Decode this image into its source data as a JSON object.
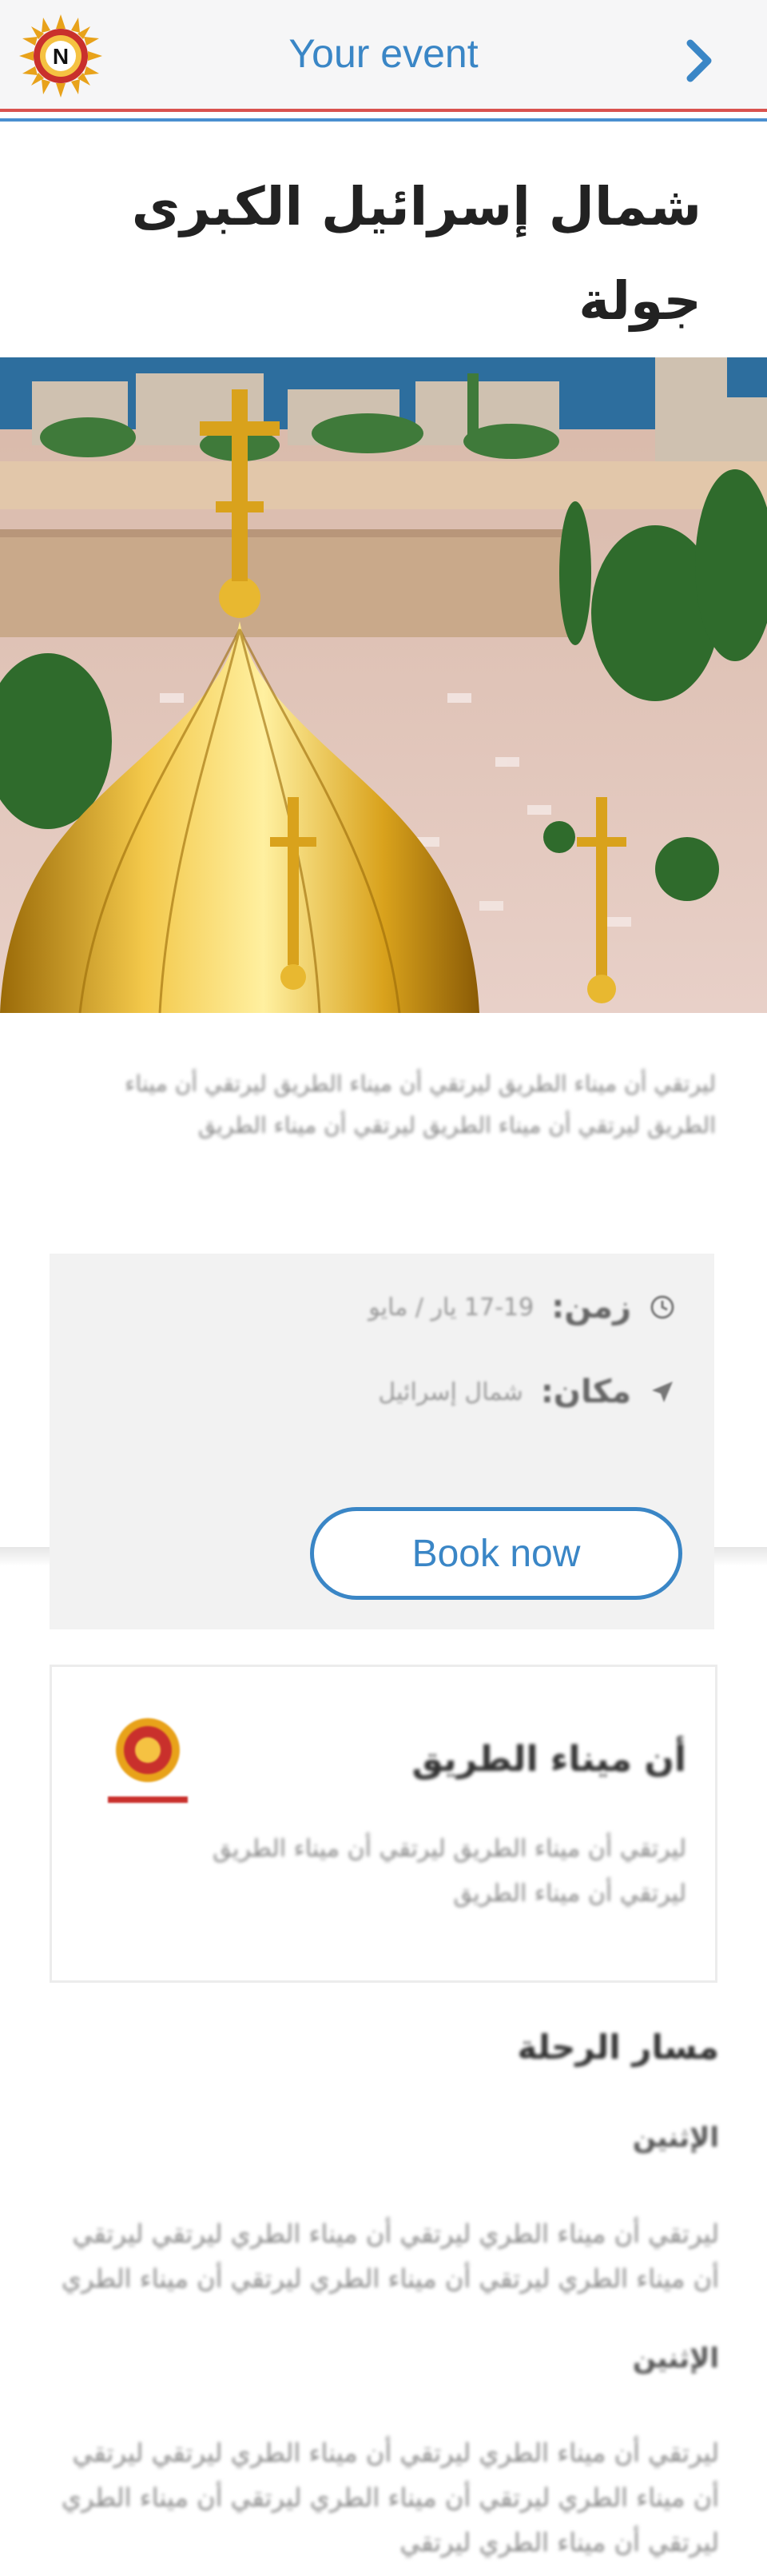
{
  "header": {
    "title": "Your event",
    "logo_letter": "N"
  },
  "event": {
    "title_line1": "شمال إسرائيل الكبرى",
    "title_line2": "جولة"
  },
  "intro": "ليرتقي أن ميناء الطريق ليرتقي أن ميناء الطريق ليرتقي أن ميناء الطريق ليرتقي أن ميناء الطريق ليرتقي أن ميناء الطريق",
  "info": {
    "time_label": "زمن:",
    "time_value": "17-19 يار / مايو",
    "place_label": "مكان:",
    "place_value": "شمال إسرائيل"
  },
  "book_button": "Book now",
  "organizer": {
    "name": "أن ميناء الطريق",
    "text": "ليرتقي أن ميناء الطريق ليرتقي أن ميناء الطريق ليرتقي أن ميناء الطريق"
  },
  "itinerary": {
    "heading": "مسار الرحلة",
    "days": [
      {
        "title": "الإثنين",
        "text": "ليرتقي أن ميناء الطري ليرتقي أن ميناء الطري ليرتقي ليرتقي أن ميناء الطري ليرتقي أن ميناء الطري ليرتقي أن ميناء الطري"
      },
      {
        "title": "الإثنين",
        "text": "ليرتقي أن ميناء الطري ليرتقي أن ميناء الطري ليرتقي ليرتقي أن ميناء الطري ليرتقي أن ميناء الطري ليرتقي أن ميناء الطري ليرتقي أن ميناء الطري ليرتقي"
      }
    ]
  },
  "colors": {
    "accent": "#3a86c6",
    "header_bg": "#f6f6f7",
    "info_bg": "#f2f2f2",
    "divider_red": "#d9534f"
  }
}
